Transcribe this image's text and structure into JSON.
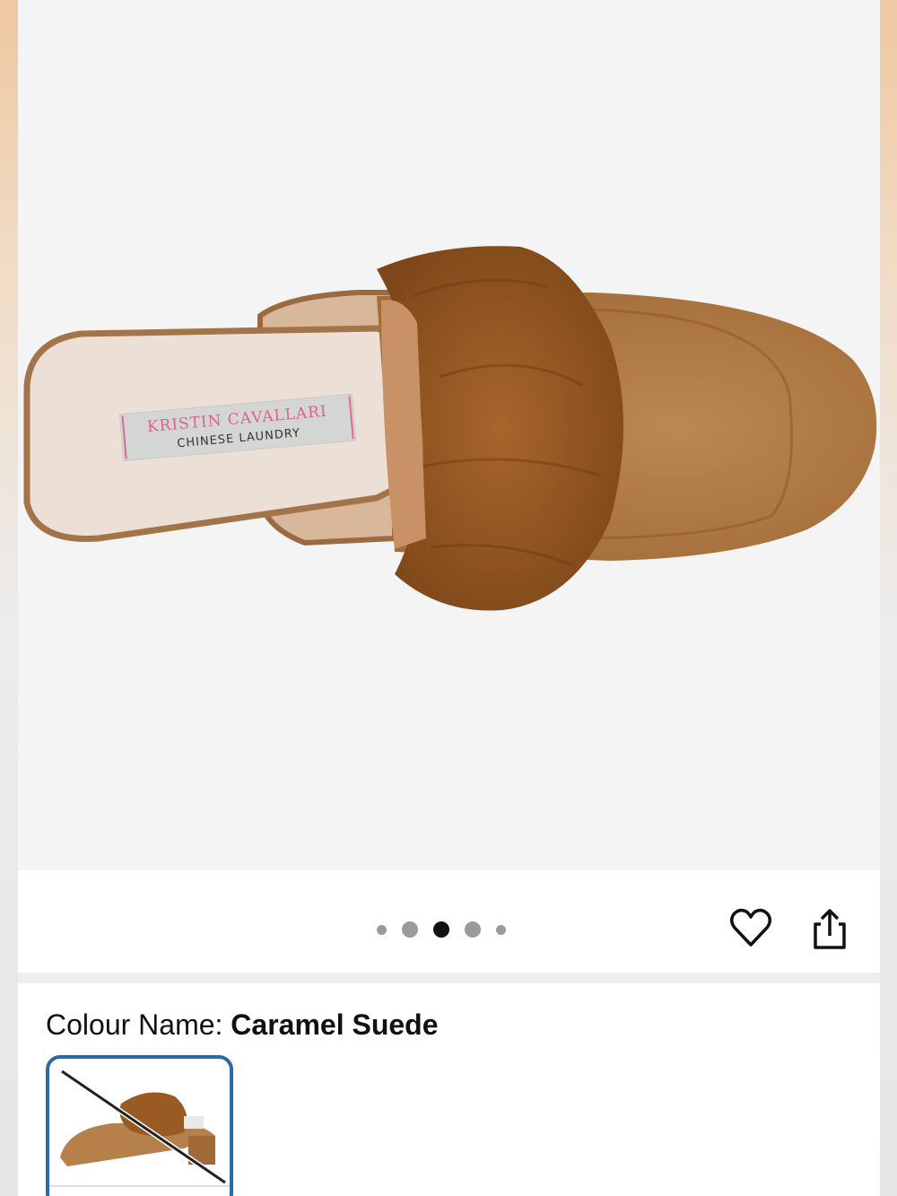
{
  "product_image": {
    "label_line1": "KRISTIN CAVALLARI",
    "label_line2": "CHINESE LAUNDRY"
  },
  "carousel": {
    "total": 5,
    "active_index": 2
  },
  "actions": {
    "favorite_icon": "heart-icon",
    "share_icon": "share-icon"
  },
  "colour": {
    "label": "Colour Name:",
    "value": "Caramel Suede",
    "swatches": [
      {
        "name": "Caramel Suede",
        "selected": true,
        "unavailable": true
      }
    ]
  },
  "colors": {
    "accent": "#2a6aa8",
    "suede": "#b07a45",
    "fur": "#9a5a24"
  }
}
